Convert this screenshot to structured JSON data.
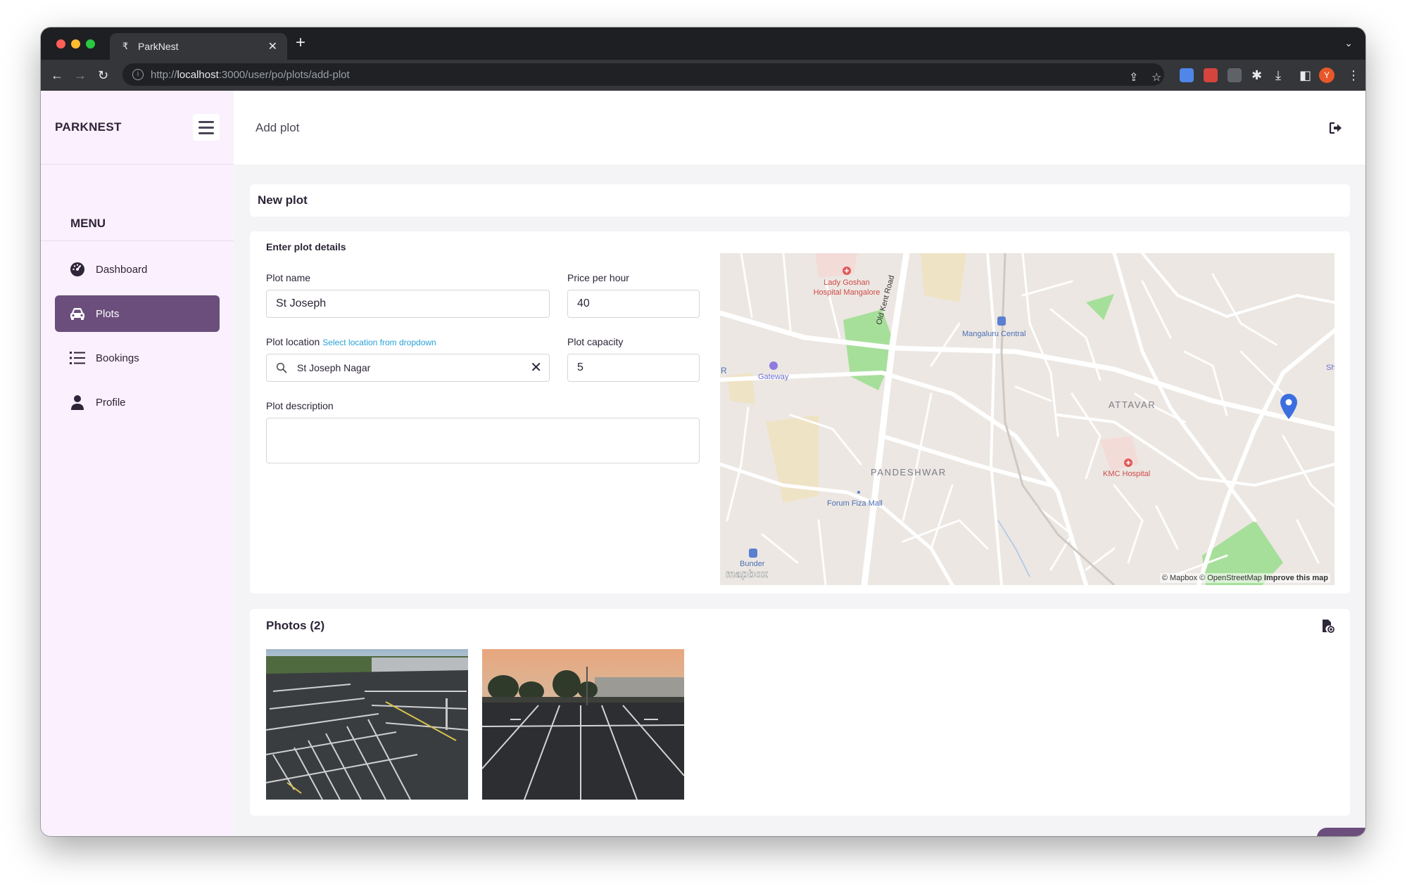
{
  "browser": {
    "tab_title": "ParkNest",
    "tab_favicon": "₹",
    "url_scheme": "http://",
    "url_host": "localhost",
    "url_path": ":3000/user/po/plots/add-plot",
    "profile_initial": "Y"
  },
  "sidebar": {
    "brand": "PARKNEST",
    "menu_label": "MENU",
    "items": [
      {
        "label": "Dashboard",
        "icon": "gauge-icon",
        "active": false
      },
      {
        "label": "Plots",
        "icon": "car-icon",
        "active": true
      },
      {
        "label": "Bookings",
        "icon": "list-icon",
        "active": false
      },
      {
        "label": "Profile",
        "icon": "user-icon",
        "active": false
      }
    ]
  },
  "header": {
    "page_title": "Add plot"
  },
  "new_plot": {
    "title": "New plot"
  },
  "details": {
    "section_title": "Enter plot details",
    "plot_name": {
      "label": "Plot name",
      "value": "St Joseph"
    },
    "price_per_hour": {
      "label": "Price per hour",
      "value": "40"
    },
    "plot_location": {
      "label": "Plot location",
      "hint": "Select location from dropdown",
      "value": "St Joseph Nagar"
    },
    "plot_capacity": {
      "label": "Plot capacity",
      "value": "5"
    },
    "plot_description": {
      "label": "Plot description",
      "value": ""
    }
  },
  "map": {
    "labels": {
      "lady_goshan_1": "Lady Goshan",
      "lady_goshan_2": "Hospital Mangalore",
      "old_kent_road": "Old Kent Road",
      "mangaluru_central": "Mangaluru Central",
      "gateway": "Gateway",
      "attavar": "ATTAVAR",
      "pandeshwar": "PANDESHWAR",
      "kmc_hospital": "KMC Hospital",
      "forum_fiza_mall": "Forum Fiza Mall",
      "bunder": "Bunder",
      "edge_r": "R",
      "edge_sh": "Sh"
    },
    "credit": "© Mapbox © OpenStreetMap",
    "improve": "Improve this map",
    "logo": "mapbox"
  },
  "photos": {
    "title": "Photos (2)",
    "count": 2
  },
  "colors": {
    "accent": "#6b4e7c",
    "sidebar_bg": "#fbf0fd",
    "link": "#26a0d8",
    "pin": "#3b6fe0"
  }
}
